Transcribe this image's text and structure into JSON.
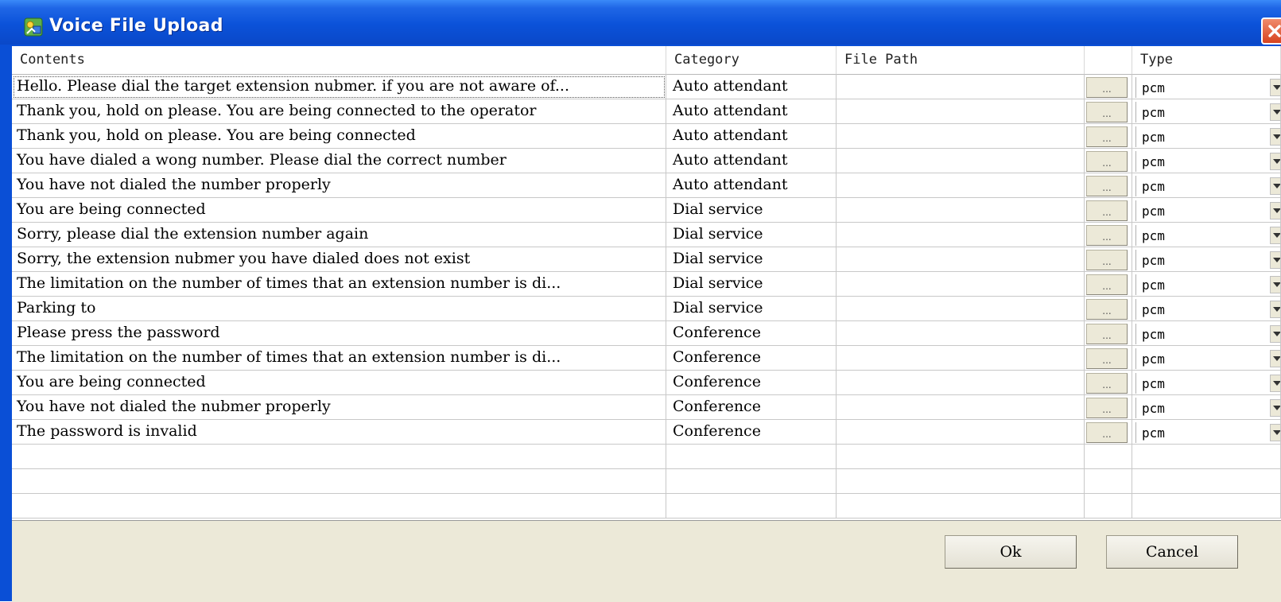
{
  "window": {
    "title": "Voice File Upload"
  },
  "columns": {
    "contents": "Contents",
    "category": "Category",
    "file_path": "File Path",
    "type": "Type"
  },
  "browse_label": "...",
  "rows": [
    {
      "contents": "Hello. Please dial the target extension nubmer. if you are not aware of...",
      "category": "Auto attendant",
      "type": "pcm"
    },
    {
      "contents": "Thank you, hold on please. You are being connected to the operator",
      "category": "Auto attendant",
      "type": "pcm"
    },
    {
      "contents": "Thank you, hold on please. You are being connected",
      "category": "Auto attendant",
      "type": "pcm"
    },
    {
      "contents": "You have dialed a wong number. Please dial the correct number",
      "category": "Auto attendant",
      "type": "pcm"
    },
    {
      "contents": "You have not dialed the number properly",
      "category": "Auto attendant",
      "type": "pcm"
    },
    {
      "contents": "You are being connected",
      "category": "Dial service",
      "type": "pcm"
    },
    {
      "contents": "Sorry, please dial the extension number again",
      "category": "Dial service",
      "type": "pcm"
    },
    {
      "contents": "Sorry, the extension nubmer you have dialed does not exist",
      "category": "Dial service",
      "type": "pcm"
    },
    {
      "contents": "The limitation on the number of times that an extension number is di...",
      "category": "Dial service",
      "type": "pcm"
    },
    {
      "contents": "Parking to",
      "category": "Dial service",
      "type": "pcm"
    },
    {
      "contents": "Please press the password",
      "category": "Conference",
      "type": "pcm"
    },
    {
      "contents": "The limitation on the number of times that an extension number is di...",
      "category": "Conference",
      "type": "pcm"
    },
    {
      "contents": "You are being connected",
      "category": "Conference",
      "type": "pcm"
    },
    {
      "contents": "You have not dialed the nubmer properly",
      "category": "Conference",
      "type": "pcm"
    },
    {
      "contents": "The password is invalid",
      "category": "Conference",
      "type": "pcm"
    }
  ],
  "footer": {
    "ok_label": "Ok",
    "cancel_label": "Cancel"
  },
  "colors": {
    "titlebar": "#0a52d9",
    "footer": "#ece9d8",
    "close": "#d7431f"
  },
  "icons": {
    "app": "voice-file-icon",
    "close": "close-icon",
    "dropdown": "chevron-down-icon"
  }
}
